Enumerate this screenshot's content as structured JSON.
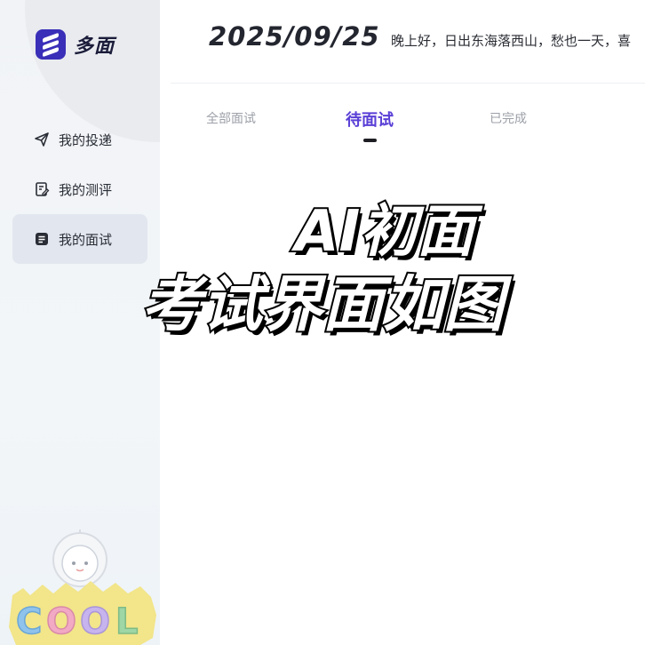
{
  "brand": {
    "name": "多面"
  },
  "sidebar": {
    "items": [
      {
        "label": "我的投递",
        "icon": "send-icon",
        "active": false
      },
      {
        "label": "我的测评",
        "icon": "assessment-icon",
        "active": false
      },
      {
        "label": "我的面试",
        "icon": "interview-icon",
        "active": true
      }
    ],
    "mascot": {
      "text": "COOL"
    }
  },
  "header": {
    "date": "2025/09/25",
    "greeting": "晚上好，日出东海落西山，愁也一天，喜"
  },
  "tabs": [
    {
      "label": "全部面试",
      "active": false
    },
    {
      "label": "待面试",
      "active": true
    },
    {
      "label": "已完成",
      "active": false
    }
  ],
  "overlay": {
    "line1": "AI初面",
    "line2": "考试界面如图"
  },
  "colors": {
    "accent": "#5a3fd6",
    "brand_logo": "#3a2fb8",
    "sidebar_active": "#e2e7ef"
  }
}
